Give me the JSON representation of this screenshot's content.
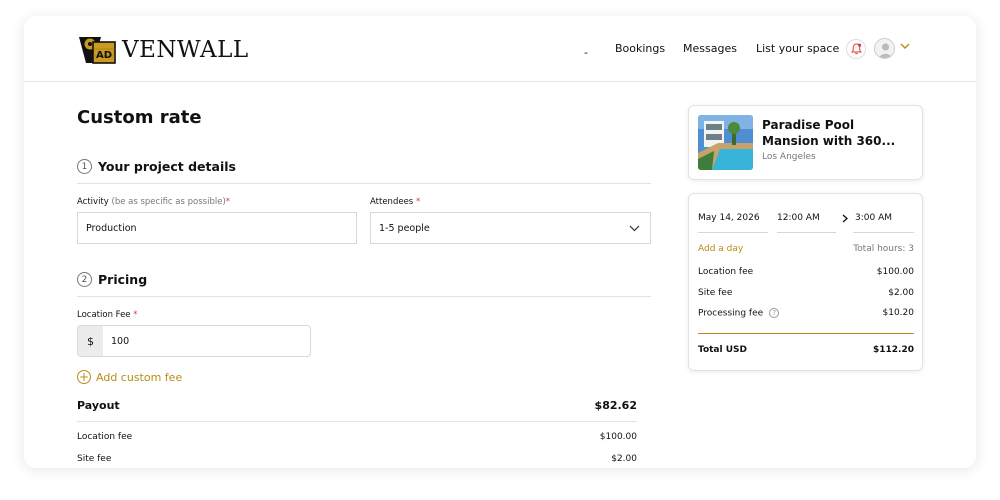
{
  "brand": {
    "name": "VENWALL",
    "mark_text": "AD"
  },
  "nav": {
    "dash": "-",
    "bookings": "Bookings",
    "messages": "Messages",
    "list_space": "List your space"
  },
  "page": {
    "title": "Custom rate"
  },
  "project": {
    "step": "1",
    "heading": "Your project details",
    "activity_label": "Activity",
    "activity_hint": "(be as specific as possible)",
    "activity_value": "Production",
    "attendees_label": "Attendees",
    "attendees_value": "1-5 people",
    "required_mark": "*"
  },
  "pricing": {
    "step": "2",
    "heading": "Pricing",
    "location_fee_label": "Location Fee",
    "currency": "$",
    "location_fee_value": "100",
    "add_custom_fee": "Add custom fee"
  },
  "payout": {
    "label": "Payout",
    "total": "$82.62",
    "items": [
      {
        "label": "Location fee",
        "value": "$100.00"
      },
      {
        "label": "Site fee",
        "value": "$2.00"
      }
    ]
  },
  "listing": {
    "title": "Paradise Pool Mansion with 360...",
    "location": "Los Angeles"
  },
  "summary": {
    "date": "May 14, 2026",
    "start_time": "12:00 AM",
    "end_time": "3:00 AM",
    "add_day": "Add a day",
    "total_hours": "Total hours: 3",
    "fees": [
      {
        "label": "Location fee",
        "value": "$100.00"
      },
      {
        "label": "Site fee",
        "value": "$2.00"
      },
      {
        "label": "Processing fee",
        "value": "$10.20"
      }
    ],
    "total_label": "Total USD",
    "total_value": "$112.20"
  },
  "colors": {
    "accent": "#b98c18",
    "required": "#dd3333",
    "notification": "#e03a3a"
  },
  "icons": [
    "logo-icon",
    "bell-icon",
    "avatar-icon",
    "chevron-down-icon",
    "chevron-right-icon",
    "plus-circle-icon",
    "help-icon"
  ]
}
